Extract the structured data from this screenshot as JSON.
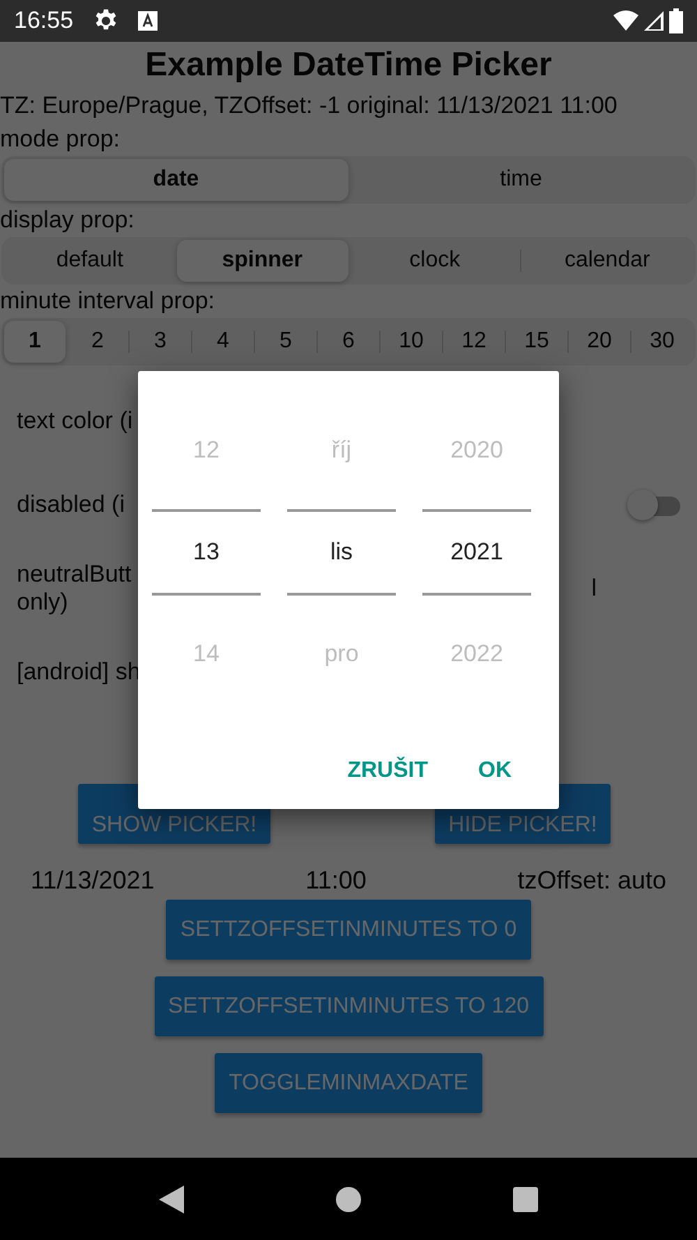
{
  "status_bar": {
    "time": "16:55"
  },
  "title": "Example DateTime Picker",
  "info": "TZ: Europe/Prague, TZOffset: -1 original: 11/13/2021 11:00",
  "mode_prop": {
    "label": "mode prop:",
    "options": [
      {
        "label": "date",
        "selected": true
      },
      {
        "label": "time",
        "selected": false
      }
    ]
  },
  "display_prop": {
    "label": "display prop:",
    "options": [
      {
        "label": "default",
        "selected": false
      },
      {
        "label": "spinner",
        "selected": true
      },
      {
        "label": "clock",
        "selected": false
      },
      {
        "label": "calendar",
        "selected": false
      }
    ]
  },
  "minute_interval_prop": {
    "label": "minute interval prop:",
    "options": [
      {
        "label": "1",
        "selected": true
      },
      {
        "label": "2",
        "selected": false
      },
      {
        "label": "3",
        "selected": false
      },
      {
        "label": "4",
        "selected": false
      },
      {
        "label": "5",
        "selected": false
      },
      {
        "label": "6",
        "selected": false
      },
      {
        "label": "10",
        "selected": false
      },
      {
        "label": "12",
        "selected": false
      },
      {
        "label": "15",
        "selected": false
      },
      {
        "label": "20",
        "selected": false
      },
      {
        "label": "30",
        "selected": false
      }
    ]
  },
  "settings": [
    {
      "kind": "text",
      "label": "text color (i"
    },
    {
      "kind": "switch",
      "label": "disabled (i",
      "on": false
    },
    {
      "kind": "text",
      "label": "neutralButt\nonly)",
      "trailing": "l"
    },
    {
      "kind": "text",
      "label": "[android] sh"
    }
  ],
  "picker_buttons": [
    "SHOW PICKER!",
    "HIDE PICKER!"
  ],
  "values": {
    "date": "11/13/2021",
    "time": "11:00",
    "tz_offset": "tzOffset: auto"
  },
  "actions": [
    "SETTZOFFSETINMINUTES TO 0",
    "SETTZOFFSETINMINUTES TO 120",
    "TOGGLEMINMAXDATE"
  ],
  "dialog": {
    "columns": [
      {
        "items": [
          {
            "label": "12",
            "selected": false
          },
          {
            "label": "13",
            "selected": true
          },
          {
            "label": "14",
            "selected": false
          }
        ]
      },
      {
        "items": [
          {
            "label": "říj",
            "selected": false
          },
          {
            "label": "lis",
            "selected": true
          },
          {
            "label": "pro",
            "selected": false
          }
        ]
      },
      {
        "items": [
          {
            "label": "2020",
            "selected": false
          },
          {
            "label": "2021",
            "selected": true
          },
          {
            "label": "2022",
            "selected": false
          }
        ]
      }
    ],
    "buttons": [
      "ZRUŠIT",
      "OK"
    ]
  }
}
